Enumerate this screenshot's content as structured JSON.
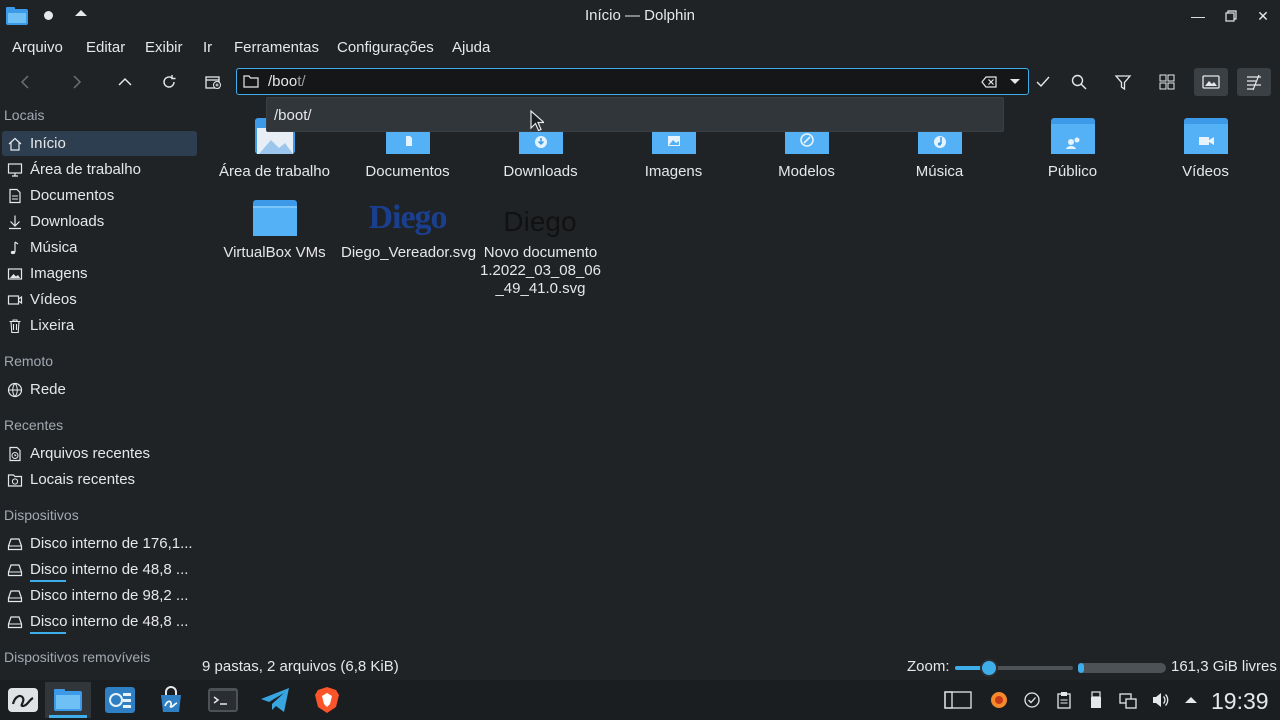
{
  "window": {
    "title": "Início — Dolphin"
  },
  "menu": [
    "Arquivo",
    "Editar",
    "Exibir",
    "Ir",
    "Ferramentas",
    "Configurações",
    "Ajuda"
  ],
  "location": {
    "typed": "/boo",
    "completion": "t/",
    "suggestion": "/boot/"
  },
  "sidebar": {
    "sections": [
      {
        "title": "Locais",
        "items": [
          "Início",
          "Área de trabalho",
          "Documentos",
          "Downloads",
          "Música",
          "Imagens",
          "Vídeos",
          "Lixeira"
        ]
      },
      {
        "title": "Remoto",
        "items": [
          "Rede"
        ]
      },
      {
        "title": "Recentes",
        "items": [
          "Arquivos recentes",
          "Locais recentes"
        ]
      },
      {
        "title": "Dispositivos",
        "items": [
          "Disco interno de 176,1...",
          "Disco interno de 48,8 ...",
          "Disco interno de 98,2 ...",
          "Disco interno de 48,8 ..."
        ]
      },
      {
        "title": "Dispositivos removíveis",
        "items": []
      }
    ]
  },
  "files": [
    {
      "name": "Área de trabalho",
      "kind": "folder-desktop"
    },
    {
      "name": "Documentos",
      "kind": "folder-documents"
    },
    {
      "name": "Downloads",
      "kind": "folder-downloads"
    },
    {
      "name": "Imagens",
      "kind": "folder-pictures"
    },
    {
      "name": "Modelos",
      "kind": "folder-templates"
    },
    {
      "name": "Música",
      "kind": "folder-music"
    },
    {
      "name": "Público",
      "kind": "folder-public"
    },
    {
      "name": "Vídeos",
      "kind": "folder-videos"
    },
    {
      "name": "VirtualBox VMs",
      "kind": "folder"
    },
    {
      "name": "Diego_Vereador.svg",
      "kind": "svg-logo",
      "preview_text": "Diego"
    },
    {
      "name": "Novo documento 1.2022_03_08_06_49_41.0.svg",
      "kind": "svg-text",
      "preview_text": "Diego"
    }
  ],
  "status": {
    "summary": "9 pastas, 2 arquivos (6,8 KiB)",
    "zoom_label": "Zoom:",
    "zoom_level": 0.25,
    "free_space": "161,3 GiB livres",
    "used_fraction": 0.07
  },
  "taskbar": {
    "clock": "19:39"
  },
  "colors": {
    "accent": "#3daee9",
    "folder": "#3d9ae8",
    "background": "#202326"
  }
}
